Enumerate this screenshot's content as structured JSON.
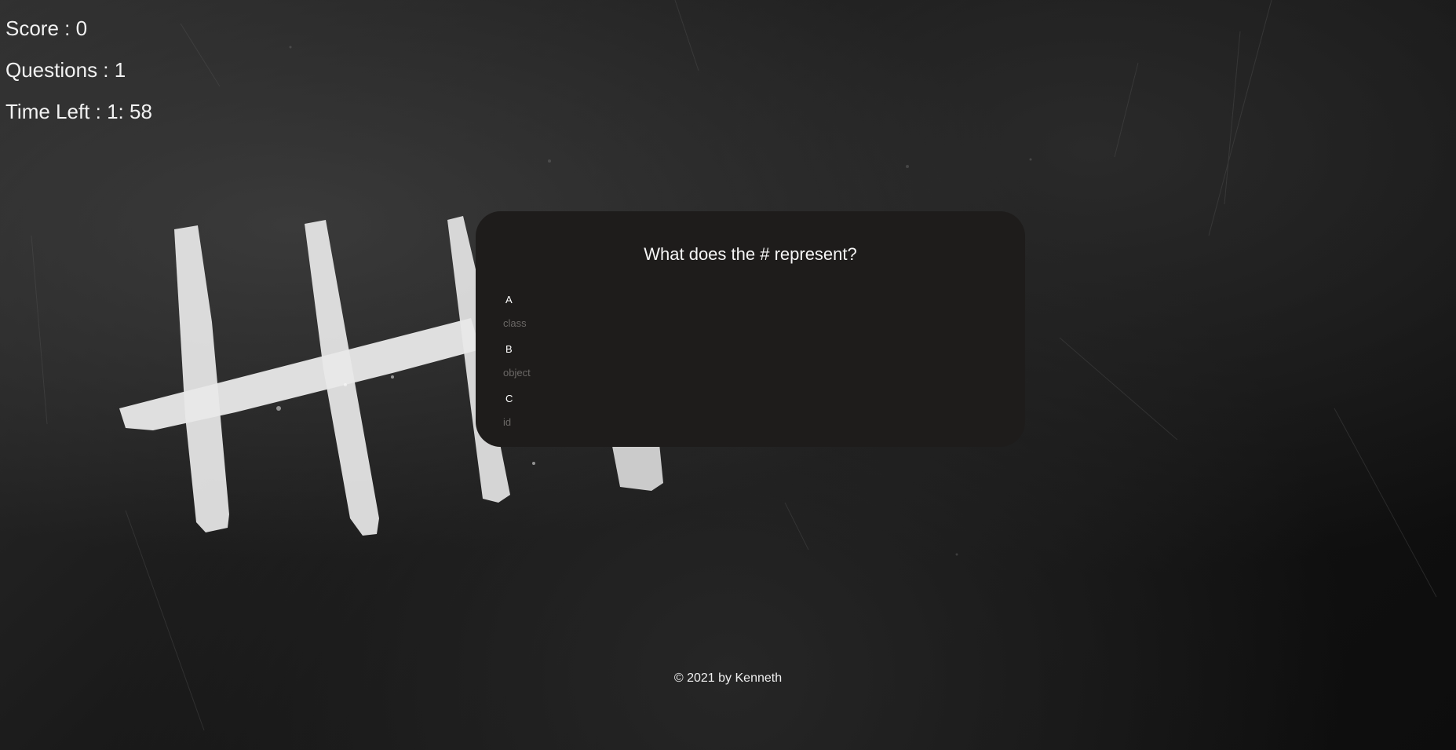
{
  "stats": {
    "score": "Score : 0",
    "questions": "Questions : 1",
    "time_left": "Time Left : 1: 58"
  },
  "quiz": {
    "question": "What does the # represent?",
    "choices": [
      {
        "letter": "A",
        "text": "class"
      },
      {
        "letter": "B",
        "text": "object"
      },
      {
        "letter": "C",
        "text": "id"
      }
    ]
  },
  "footer": {
    "copyright": "© 2021 by Kenneth"
  },
  "colors": {
    "card_background": "#1e1c1b",
    "choice_text": "#6b6866",
    "text": "#ffffff"
  }
}
